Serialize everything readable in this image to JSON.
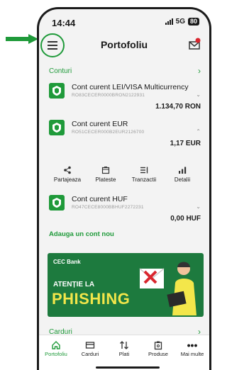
{
  "status": {
    "time": "14:44",
    "network": "5G",
    "battery": "80"
  },
  "header": {
    "title": "Portofoliu"
  },
  "accounts_section": {
    "label": "Conturi"
  },
  "accounts": [
    {
      "name": "Cont curent LEI/VISA Multicurrency",
      "iban": "RO83CECER0000BRON2122931",
      "balance": "1.134,70 RON",
      "expanded": false
    },
    {
      "name": "Cont curent EUR",
      "iban": "RO51CECER000B2EUR2126700",
      "balance": "1,17 EUR",
      "expanded": true
    },
    {
      "name": "Cont curent HUF",
      "iban": "RO47CECE8000BBHUF2272231",
      "balance": "0,00 HUF",
      "expanded": false
    }
  ],
  "actions": [
    {
      "label": "Partajeaza",
      "icon": "share-icon"
    },
    {
      "label": "Plateste",
      "icon": "pay-icon"
    },
    {
      "label": "Tranzactii",
      "icon": "transactions-icon"
    },
    {
      "label": "Detalii",
      "icon": "details-icon"
    }
  ],
  "add_account": {
    "label": "Adauga un cont nou"
  },
  "banner": {
    "brand": "CEC Bank",
    "line1": "ATENȚIE LA",
    "line2": "PHISHING"
  },
  "cards_section": {
    "label": "Carduri"
  },
  "tabbar": [
    {
      "label": "Portofoliu",
      "icon": "home-icon",
      "active": true
    },
    {
      "label": "Carduri",
      "icon": "card-icon",
      "active": false
    },
    {
      "label": "Plati",
      "icon": "transfer-icon",
      "active": false
    },
    {
      "label": "Produse",
      "icon": "products-icon",
      "active": false
    },
    {
      "label": "Mai multe",
      "icon": "more-icon",
      "active": false
    }
  ],
  "colors": {
    "accent": "#1f9a3a",
    "banner": "#1d7a3e",
    "phishing": "#f3e64a"
  }
}
